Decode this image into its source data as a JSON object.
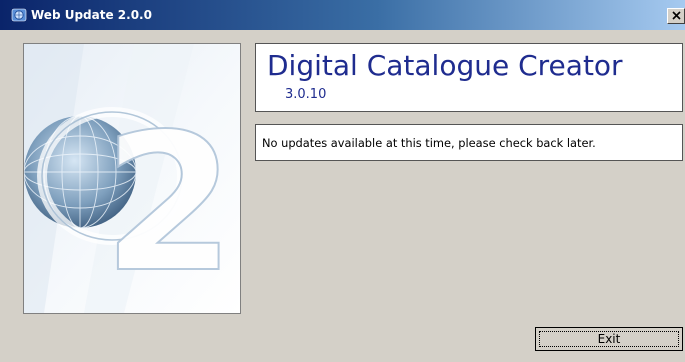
{
  "window": {
    "title": "Web Update 2.0.0",
    "app_icon": "web-update-icon",
    "close_icon": "close-icon"
  },
  "header": {
    "product_name": "Digital Catalogue Creator",
    "product_version": "3.0.10"
  },
  "status": {
    "message": "No updates available at this time, please check back later."
  },
  "actions": {
    "exit_label": "Exit"
  },
  "side_panel": {
    "image": "globe-2-splash",
    "glyph": "2"
  },
  "colors": {
    "title_bar_start": "#0a246a",
    "title_bar_end": "#a6caf0",
    "dialog_background": "#d4d0c8",
    "product_text": "#1f2c8f"
  }
}
